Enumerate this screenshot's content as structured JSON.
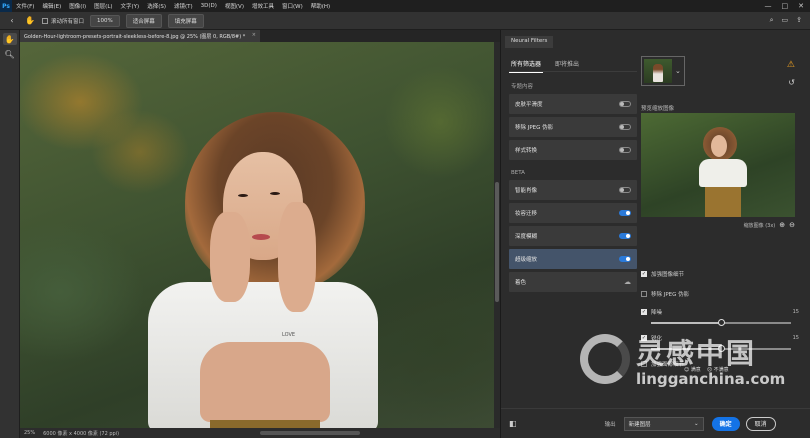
{
  "menubar": {
    "logo": "Ps",
    "items": [
      "文件(F)",
      "编辑(E)",
      "图像(I)",
      "图层(L)",
      "文字(Y)",
      "选择(S)",
      "滤镜(T)",
      "3D(D)",
      "视图(V)",
      "增效工具",
      "窗口(W)",
      "帮助(H)"
    ],
    "window_controls": [
      "—",
      "□",
      "✕"
    ]
  },
  "optionsbar": {
    "scroll_all_label": "滚动所有窗口",
    "zoom_value": "100%",
    "fit_screen_label": "适合屏幕",
    "fill_screen_label": "填充屏幕"
  },
  "document": {
    "tab_title": "Golden-Hour-lightroom-presets-portrait-sleekless-before-8.jpg @ 25% (图层 0, RGB/8#) *",
    "close_glyph": "×",
    "shirt_print": "LOVE"
  },
  "statusbar": {
    "zoom": "25%",
    "doc_size": "6000 像素 x 4000 像素 (72 ppi)"
  },
  "neural_filters": {
    "panel_tab": "Neural Filters",
    "tabs": [
      "所有筛选器",
      "即将推出"
    ],
    "sections": [
      {
        "label": "专题内容",
        "filters": [
          {
            "name": "皮肤平滑度",
            "state": "off"
          },
          {
            "name": "移除 JPEG 伪影",
            "state": "off"
          },
          {
            "name": "样式转换",
            "state": "off"
          }
        ]
      },
      {
        "label": "BETA",
        "filters": [
          {
            "name": "智能肖像",
            "state": "off"
          },
          {
            "name": "妆容迁移",
            "state": "on"
          },
          {
            "name": "深度模糊",
            "state": "on"
          },
          {
            "name": "超级缩放",
            "state": "on",
            "selected": true
          },
          {
            "name": "着色",
            "state": "cloud"
          }
        ]
      }
    ],
    "settings": {
      "preview_label": "预览缩放图像",
      "zoom_hint": "缩放图像 (3x)",
      "options": [
        {
          "label": "加强图像细节",
          "checked": true
        },
        {
          "label": "移除 JPEG 伪影",
          "checked": false
        },
        {
          "label": "降噪",
          "checked": true,
          "value": "15",
          "slider": 0.5
        },
        {
          "label": "锐化",
          "checked": true,
          "value": "15",
          "slider": 0.5
        },
        {
          "label": "加强面部细节",
          "checked": false
        }
      ]
    },
    "footer": {
      "output_label": "输出",
      "output_value": "新建图层",
      "ok_label": "确定",
      "cancel_label": "取消"
    }
  },
  "watermark": {
    "cn": "灵感中国",
    "en": "lingganchina.com",
    "mini_left": "☺ 满意",
    "mini_right": "☹ 不满意"
  },
  "colors": {
    "accent": "#1473e6",
    "toggle_on": "#2b7ad9",
    "selected_filter": "#44546a",
    "warning": "#f5a623"
  }
}
